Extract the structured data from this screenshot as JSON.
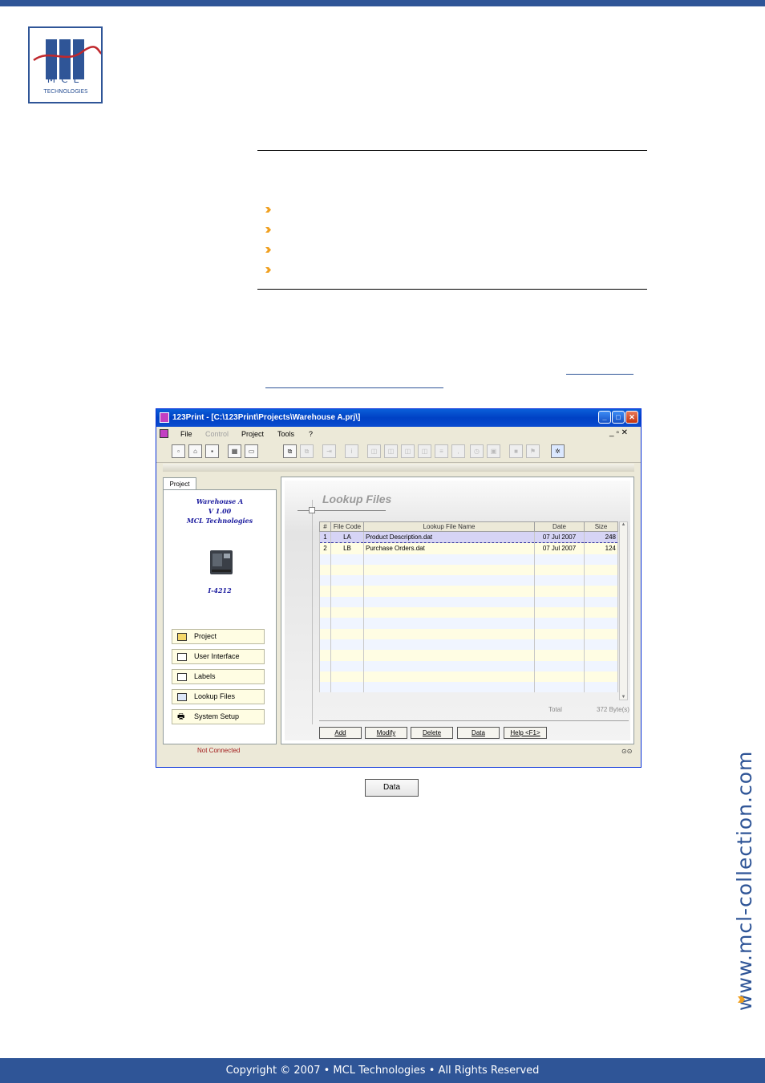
{
  "page": {
    "footer": "Copyright © 2007 • MCL Technologies • All Rights Reserved",
    "website": "www.mcl-collection.com",
    "logo": {
      "letters": [
        "M",
        "C",
        "L"
      ],
      "subtitle": "TECHNOLOGIES"
    },
    "accent_color": "#2f5597",
    "bullet_color": "#f0a020",
    "bullets": 4
  },
  "app": {
    "title": "123Print - [C:\\123Print\\Projects\\Warehouse A.prj\\]",
    "menu": [
      "File",
      "Control",
      "Project",
      "Tools",
      "?"
    ],
    "menu_disabled": [
      "Control"
    ],
    "left_panel": {
      "tab": "Project",
      "project_name": "Warehouse A",
      "version": "V 1.00",
      "company": "MCL Technologies",
      "printer_model": "I-4212",
      "nav": [
        "Project",
        "User Interface",
        "Labels",
        "Lookup Files",
        "System Setup"
      ]
    },
    "lookup": {
      "title": "Lookup Files",
      "columns": [
        "#",
        "File Code",
        "Lookup File Name",
        "Date",
        "Size"
      ],
      "rows": [
        [
          "1",
          "LA",
          "Product Description.dat",
          "07 Jul 2007",
          "248"
        ],
        [
          "2",
          "LB",
          "Purchase Orders.dat",
          "07 Jul 2007",
          "124"
        ]
      ],
      "total_label": "Total",
      "total_value": "372 Byte(s)"
    },
    "buttons": [
      "Add",
      "Modify",
      "Delete",
      "Data",
      "Help <F1>"
    ],
    "status": "Not Connected"
  },
  "standalone_button": "Data"
}
